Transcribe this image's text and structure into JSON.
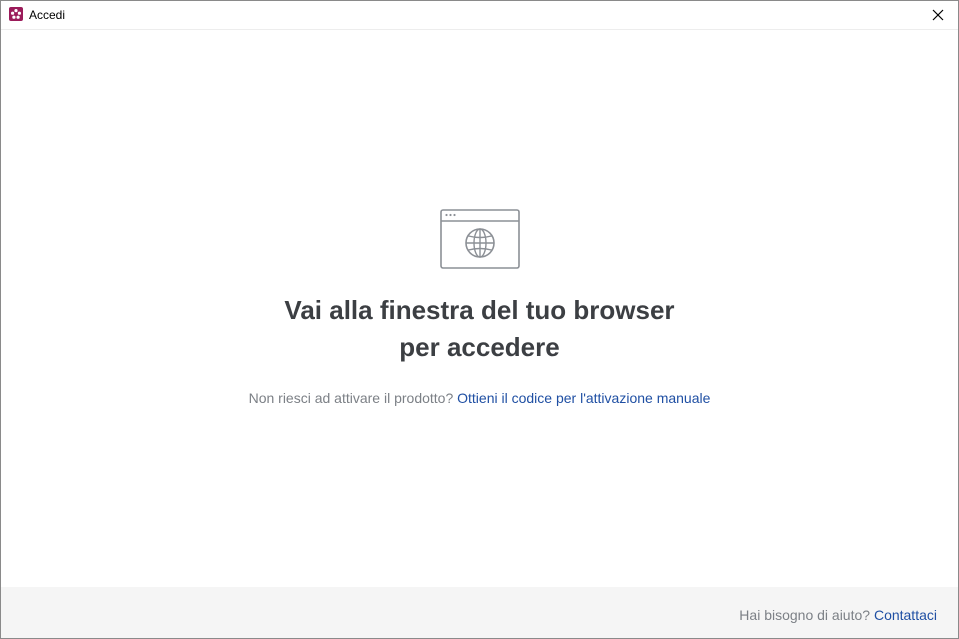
{
  "window": {
    "title": "Accedi",
    "app_icon": "app-logo-icon",
    "close_icon": "close-icon"
  },
  "main": {
    "illustration_icon": "browser-globe-icon",
    "heading_line1": "Vai alla finestra del tuo browser",
    "heading_line2": "per accedere",
    "help_question": "Non riesci ad attivare il prodotto?",
    "help_link": "Ottieni il codice per l'attivazione manuale"
  },
  "footer": {
    "question": "Hai bisogno di aiuto?",
    "link": "Contattaci"
  },
  "colors": {
    "brand": "#9b1b5a",
    "heading": "#3c3f43",
    "muted": "#7c8086",
    "link": "#1f4fa3",
    "footer_bg": "#f5f5f5"
  }
}
